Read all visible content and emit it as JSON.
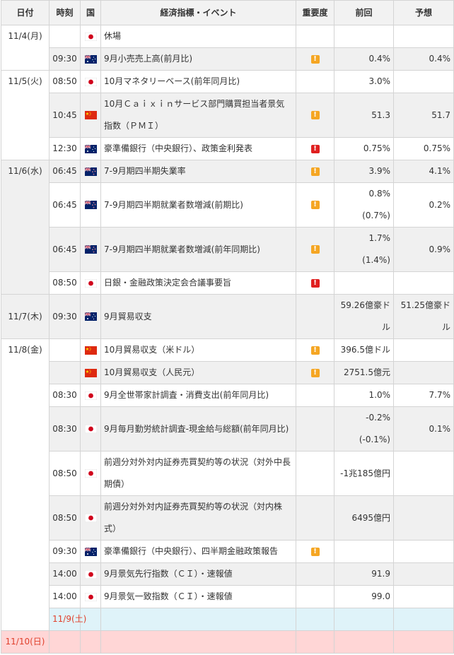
{
  "headers": {
    "date": "日付",
    "time": "時刻",
    "country": "国",
    "event": "経済指標・イベント",
    "importance": "重要度",
    "previous": "前回",
    "forecast": "予想"
  },
  "colors": {
    "header_bg": "#f2f2f2",
    "alt_row_bg": "#f0f0f0",
    "saturday_bg": "#dff3f9",
    "sunday_bg": "#ffd6d6",
    "weekend_text": "#e0402c",
    "importance_mid": "#f5a623",
    "importance_high": "#e02020"
  },
  "rows": [
    {
      "date": "11/4(月)",
      "time": "",
      "country": "jp-flag",
      "event": "休場",
      "importance": "",
      "previous": "",
      "forecast": ""
    },
    {
      "date": "",
      "time": "09:30",
      "country": "au-flag",
      "event": "9月小売売上高(前月比)",
      "importance": "mid",
      "previous": "0.4%",
      "forecast": "0.4%"
    },
    {
      "date": "11/5(火)",
      "time": "08:50",
      "country": "jp-flag",
      "event": "10月マネタリーベース(前年同月比)",
      "importance": "",
      "previous": "3.0%",
      "forecast": ""
    },
    {
      "date": "",
      "time": "10:45",
      "country": "cn-flag",
      "event": "10月Ｃａｉｘｉｎサービス部門購買担当者景気指数（ＰＭＩ）",
      "importance": "mid",
      "previous": "51.3",
      "forecast": "51.7"
    },
    {
      "date": "",
      "time": "12:30",
      "country": "au-flag",
      "event": "豪準備銀行（中央銀行）、政策金利発表",
      "importance": "high",
      "previous": "0.75%",
      "forecast": "0.75%"
    },
    {
      "date": "11/6(水)",
      "time": "06:45",
      "country": "nz-flag",
      "event": "7-9月期四半期失業率",
      "importance": "mid",
      "previous": "3.9%",
      "forecast": "4.1%"
    },
    {
      "date": "",
      "time": "06:45",
      "country": "nz-flag",
      "event": "7-9月期四半期就業者数増減(前期比)",
      "importance": "mid",
      "previous": "0.8%",
      "previous_sub": "(0.7%)",
      "forecast": "0.2%"
    },
    {
      "date": "",
      "time": "06:45",
      "country": "nz-flag",
      "event": "7-9月期四半期就業者数増減(前年同期比)",
      "importance": "mid",
      "previous": "1.7%",
      "previous_sub": "(1.4%)",
      "forecast": "0.9%"
    },
    {
      "date": "",
      "time": "08:50",
      "country": "jp-flag",
      "event": "日銀・金融政策決定会合議事要旨",
      "importance": "high",
      "previous": "",
      "forecast": ""
    },
    {
      "date": "11/7(木)",
      "time": "09:30",
      "country": "au-flag",
      "event": "9月貿易収支",
      "importance": "",
      "previous": "59.26億豪ドル",
      "forecast": "51.25億豪ドル"
    },
    {
      "date": "11/8(金)",
      "time": "",
      "country": "cn-flag",
      "event": "10月貿易収支（米ドル）",
      "importance": "mid",
      "previous": "396.5億ドル",
      "forecast": ""
    },
    {
      "date": "",
      "time": "",
      "country": "cn-flag",
      "event": "10月貿易収支（人民元）",
      "importance": "mid",
      "previous": "2751.5億元",
      "forecast": ""
    },
    {
      "date": "",
      "time": "08:30",
      "country": "jp-flag",
      "event": "9月全世帯家計調査・消費支出(前年同月比)",
      "importance": "",
      "previous": "1.0%",
      "forecast": "7.7%"
    },
    {
      "date": "",
      "time": "08:30",
      "country": "jp-flag",
      "event": "9月毎月勤労統計調査-現金給与総額(前年同月比)",
      "importance": "",
      "previous": "-0.2%",
      "previous_sub": "(-0.1%)",
      "forecast": "0.1%"
    },
    {
      "date": "",
      "time": "08:50",
      "country": "jp-flag",
      "event": "前週分対外対内証券売買契約等の状況（対外中長期債）",
      "importance": "",
      "previous": "-1兆185億円",
      "forecast": ""
    },
    {
      "date": "",
      "time": "08:50",
      "country": "jp-flag",
      "event": "前週分対外対内証券売買契約等の状況（対内株式）",
      "importance": "",
      "previous": "6495億円",
      "forecast": ""
    },
    {
      "date": "",
      "time": "09:30",
      "country": "au-flag",
      "event": "豪準備銀行（中央銀行）、四半期金融政策報告",
      "importance": "mid",
      "previous": "",
      "forecast": ""
    },
    {
      "date": "",
      "time": "14:00",
      "country": "jp-flag",
      "event": "9月景気先行指数（ＣＩ）・速報値",
      "importance": "",
      "previous": "91.9",
      "forecast": ""
    },
    {
      "date": "",
      "time": "14:00",
      "country": "jp-flag",
      "event": "9月景気一致指数（ＣＩ）・速報値",
      "importance": "",
      "previous": "99.0",
      "forecast": ""
    }
  ],
  "weekend": [
    {
      "date": "11/9(土)"
    },
    {
      "date": "11/10(日)"
    }
  ],
  "importance_icon": "!"
}
